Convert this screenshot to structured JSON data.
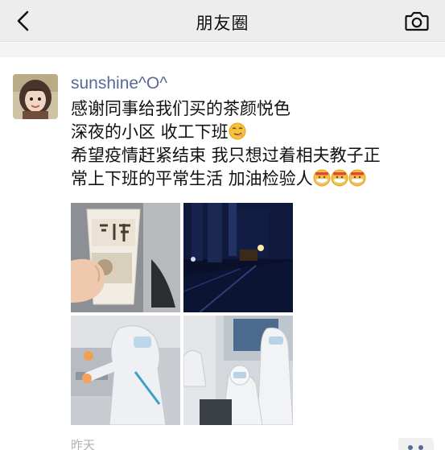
{
  "header": {
    "title": "朋友圈",
    "back_icon": "back-chevron-icon",
    "camera_icon": "camera-icon"
  },
  "post": {
    "username": "sunshine^O^",
    "lines": [
      "感谢同事给我们买的茶颜悦色",
      "深夜的小区  收工下班",
      "希望疫情赶紧结束 我只想过着相夫教子正",
      "常上下班的平常生活 加油检验人"
    ],
    "emoji_line2": "smirk-emoji",
    "emoji_line4": [
      "mask-face-emoji",
      "mask-face-emoji",
      "mask-face-emoji"
    ],
    "photos": [
      {
        "name": "tea-cup-photo"
      },
      {
        "name": "night-street-photo"
      },
      {
        "name": "lab-worker-photo"
      },
      {
        "name": "sample-collection-photo"
      }
    ],
    "time": "昨天"
  },
  "colors": {
    "link": "#576b95",
    "header_bg": "#ededed",
    "meta": "#b2b2b2"
  }
}
